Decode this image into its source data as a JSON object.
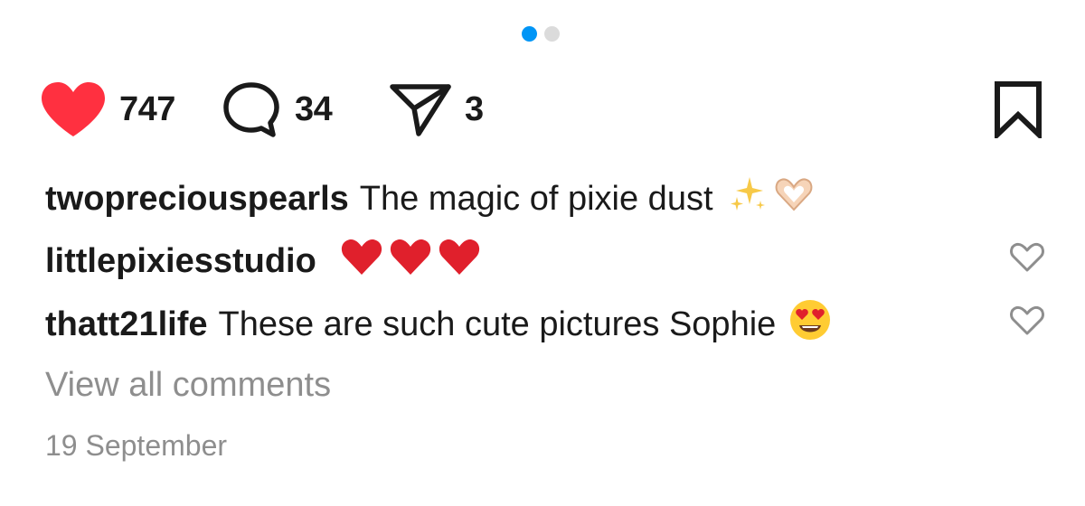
{
  "carousel": {
    "total": 2,
    "active_index": 0
  },
  "actions": {
    "likes": "747",
    "comments": "34",
    "shares": "3",
    "like_icon": "heart-filled-icon",
    "comment_icon": "comment-bubble-icon",
    "share_icon": "paper-plane-icon",
    "save_icon": "bookmark-icon"
  },
  "caption": {
    "username": "twopreciouspearls",
    "text": "The magic of pixie dust",
    "emojis": [
      "sparkles-icon",
      "heart-hands-icon"
    ]
  },
  "comments": [
    {
      "username": "littlepixiesstudio",
      "text": "",
      "emojis": [
        "red-heart-icon",
        "red-heart-icon",
        "red-heart-icon"
      ]
    },
    {
      "username": "thatt21life",
      "text": "These are such cute pictures Sophie",
      "emojis": [
        "heart-eyes-face-icon"
      ]
    }
  ],
  "view_all_label": "View all comments",
  "date": "19 September",
  "colors": {
    "like": "#ff3040",
    "accent_dot": "#0095f6",
    "muted": "#8e8e8e",
    "text": "#1a1a1a"
  }
}
